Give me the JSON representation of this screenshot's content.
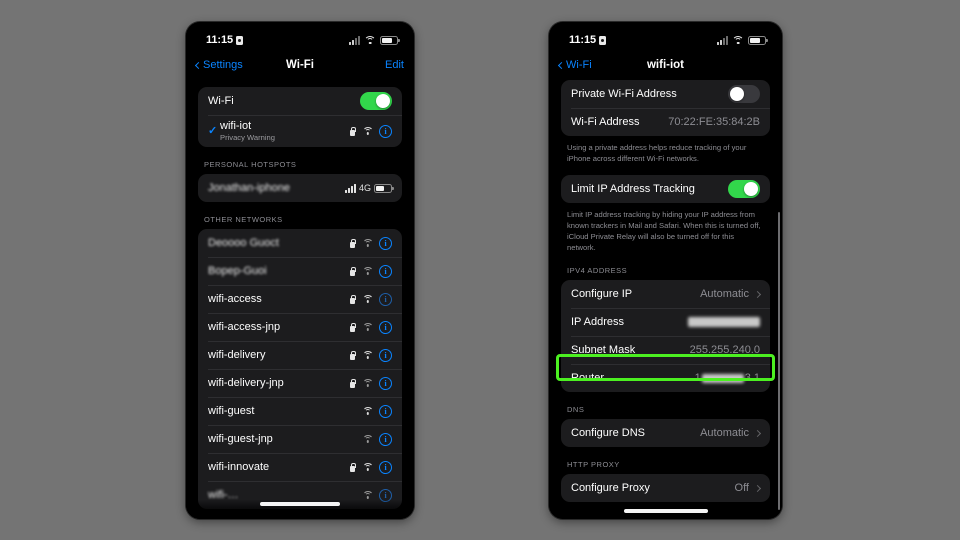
{
  "background_color": "#747474",
  "accent_blue": "#0A84FF",
  "toggle_green": "#32D74B",
  "highlight_green": "#4CF021",
  "left_phone": {
    "status_bar": {
      "time": "11:15",
      "lock_icon": "lock-icon",
      "signal_icon": "cellular-bars-icon",
      "wifi_icon": "wifi-icon",
      "battery_icon": "battery-icon"
    },
    "nav": {
      "back_label": "Settings",
      "title": "Wi-Fi",
      "edit_label": "Edit"
    },
    "wifi_toggle": {
      "label": "Wi-Fi",
      "state": "on"
    },
    "connected_network": {
      "name": "wifi-iot",
      "subtitle": "Privacy Warning",
      "checkmark": "✓",
      "lock_icon": "lock-icon",
      "wifi_icon": "wifi-signal-icon",
      "info_icon": "info-icon"
    },
    "personal_hotspots": {
      "header": "PERSONAL HOTSPOTS",
      "items": [
        {
          "name": "Jonathan-iphone",
          "redacted": true,
          "signal": "cellular-bars-icon",
          "network_type": "4G",
          "battery": "battery-icon"
        }
      ]
    },
    "other_networks": {
      "header": "OTHER NETWORKS",
      "items": [
        {
          "name": "Deoooo Guoct",
          "redacted": true,
          "secured": true,
          "signal": "strong",
          "info": true
        },
        {
          "name": "Bopep-Guoi",
          "redacted": true,
          "secured": true,
          "signal": "weak",
          "info": true
        },
        {
          "name": "wifi-access",
          "redacted": false,
          "secured": true,
          "signal": "strong",
          "info": true
        },
        {
          "name": "wifi-access-jnp",
          "redacted": false,
          "secured": true,
          "signal": "weak",
          "info": true
        },
        {
          "name": "wifi-delivery",
          "redacted": false,
          "secured": true,
          "signal": "strong",
          "info": true
        },
        {
          "name": "wifi-delivery-jnp",
          "redacted": false,
          "secured": true,
          "signal": "weak",
          "info": true
        },
        {
          "name": "wifi-guest",
          "redacted": false,
          "secured": false,
          "signal": "strong",
          "info": true
        },
        {
          "name": "wifi-guest-jnp",
          "redacted": false,
          "secured": false,
          "signal": "weak",
          "info": true
        },
        {
          "name": "wifi-innovate",
          "redacted": false,
          "secured": true,
          "signal": "strong",
          "info": true
        }
      ]
    }
  },
  "right_phone": {
    "status_bar": {
      "time": "11:15",
      "lock_icon": "lock-icon",
      "signal_icon": "cellular-bars-icon",
      "wifi_icon": "wifi-icon",
      "battery_icon": "battery-icon"
    },
    "nav": {
      "back_label": "Wi-Fi",
      "title": "wifi-iot"
    },
    "private_address_group": {
      "rows": [
        {
          "label": "Private Wi-Fi Address",
          "type": "toggle",
          "state": "off"
        },
        {
          "label": "Wi-Fi Address",
          "type": "value",
          "value": "70:22:FE:35:84:2B"
        }
      ],
      "footer": "Using a private address helps reduce tracking of your iPhone across different Wi-Fi networks."
    },
    "limit_ip_group": {
      "rows": [
        {
          "label": "Limit IP Address Tracking",
          "type": "toggle",
          "state": "on"
        }
      ],
      "footer": "Limit IP address tracking by hiding your IP address from known trackers in Mail and Safari. When this is turned off, iCloud Private Relay will also be turned off for this network."
    },
    "ipv4_section": {
      "header": "IPV4 ADDRESS",
      "rows": [
        {
          "label": "Configure IP",
          "value": "Automatic",
          "chevron": true
        },
        {
          "label": "IP Address",
          "value": "",
          "redacted": true
        },
        {
          "label": "Subnet Mask",
          "value": "255.255.240.0"
        },
        {
          "label": "Router",
          "value_prefix": "1",
          "value_suffix": "3.1",
          "redacted_middle": true,
          "highlighted": true
        }
      ]
    },
    "dns_section": {
      "header": "DNS",
      "rows": [
        {
          "label": "Configure DNS",
          "value": "Automatic",
          "chevron": true
        }
      ]
    },
    "proxy_section": {
      "header": "HTTP PROXY",
      "rows": [
        {
          "label": "Configure Proxy",
          "value": "Off",
          "chevron": true
        }
      ]
    }
  }
}
